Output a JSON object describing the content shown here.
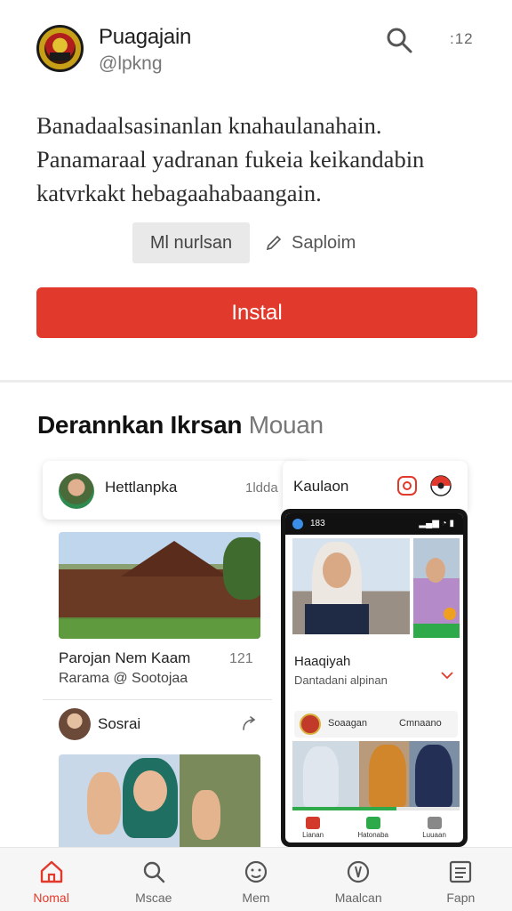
{
  "header": {
    "title": "Puagajain",
    "handle": "@lpkng",
    "more_label": ":12"
  },
  "description": [
    "Banadaalsasinanlan knahaulanahain.",
    "Panamaraal yadranan fukeia keikandabin",
    "katvrkakt hebagaahabaangain."
  ],
  "chips": {
    "primary": "Ml nurlsan",
    "secondary": "Saploim"
  },
  "install_label": "Instal",
  "section": {
    "title_bold": "Derannkan Ikrsan",
    "title_muted": "Mouan"
  },
  "preview": {
    "left_card": {
      "name": "Hettlanpka",
      "meta": "1ldda",
      "post_title": "Parojan Nem Kaam",
      "post_count": "121",
      "post_sub": "Rarama @ Sootojaa",
      "user_name": "Sosrai"
    },
    "right_card": {
      "name": "Kaulaon"
    },
    "phone": {
      "status_time": "183",
      "title": "Haaqiyah",
      "subtitle": "Dantadani alpinan",
      "row_left": "Soaagan",
      "row_right": "Cmnaano",
      "progress": 0.62,
      "nav": [
        "Lianan",
        "Hatonaba",
        "Luuaan"
      ],
      "nav_colors": [
        "#d33a2c",
        "#2eaa4a",
        "#888888"
      ]
    }
  },
  "bottom_nav": [
    {
      "label": "Nomal",
      "icon": "home-icon",
      "active": true
    },
    {
      "label": "Mscae",
      "icon": "search-icon",
      "active": false
    },
    {
      "label": "Mem",
      "icon": "face-icon",
      "active": false
    },
    {
      "label": "Maalcan",
      "icon": "shield-icon",
      "active": false
    },
    {
      "label": "Fapn",
      "icon": "list-icon",
      "active": false
    }
  ],
  "colors": {
    "accent": "#e13a2c",
    "muted_text": "#777777"
  }
}
